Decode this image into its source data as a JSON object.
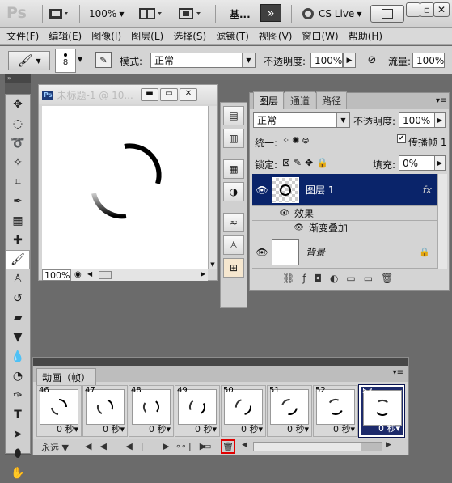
{
  "app": {
    "logo": "Ps",
    "zoom": "100%",
    "workspace": "基...",
    "cs_live": "CS Live"
  },
  "menu": [
    "文件(F)",
    "编辑(E)",
    "图像(I)",
    "图层(L)",
    "选择(S)",
    "滤镜(T)",
    "视图(V)",
    "窗口(W)",
    "帮助(H)"
  ],
  "options": {
    "brush_size": "8",
    "mode_label": "模式:",
    "mode_value": "正常",
    "opacity_label": "不透明度:",
    "opacity_value": "100%",
    "flow_label": "流量:",
    "flow_value": "100%"
  },
  "document": {
    "title": "未标题-1 @ 10...",
    "ps_badge": "Ps",
    "zoom": "100%"
  },
  "layers_panel": {
    "tabs": [
      "图层",
      "通道",
      "路径"
    ],
    "blend_mode": "正常",
    "opacity_label": "不透明度:",
    "opacity_value": "100%",
    "unify_label": "统一:",
    "propagate_label": "传播帧 1",
    "lock_label": "锁定:",
    "fill_label": "填充:",
    "fill_value": "0%",
    "layers": [
      {
        "name": "图层 1",
        "selected": true
      },
      {
        "name": "背景",
        "selected": false
      }
    ],
    "effects_label": "效果",
    "effect_name": "渐变叠加"
  },
  "animation_panel": {
    "title": "动画（帧）",
    "frames": [
      {
        "num": "46",
        "delay": "0 秒▾"
      },
      {
        "num": "47",
        "delay": "0 秒▾"
      },
      {
        "num": "48",
        "delay": "0 秒▾"
      },
      {
        "num": "49",
        "delay": "0 秒▾"
      },
      {
        "num": "50",
        "delay": "0 秒▾"
      },
      {
        "num": "51",
        "delay": "0 秒▾"
      },
      {
        "num": "52",
        "delay": "0 秒▾"
      },
      {
        "num": "53",
        "delay": "0 秒▾"
      }
    ],
    "loop_value": "永远"
  },
  "colors": {
    "selection": "#0a246a",
    "highlight_red": "#e00000"
  }
}
